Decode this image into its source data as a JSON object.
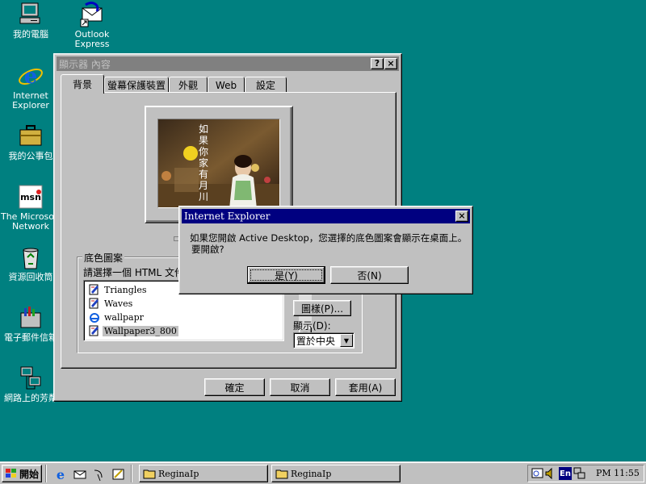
{
  "desktop": {
    "icons": [
      {
        "label": "我的電腦"
      },
      {
        "label": "Outlook Express"
      },
      {
        "label": "Internet Explorer"
      },
      {
        "label": "我的公事包"
      },
      {
        "label": "The Microsoft Network"
      },
      {
        "label": "資源回收筒"
      },
      {
        "label": "電子郵件信箱"
      },
      {
        "label": "網路上的芳鄰"
      }
    ]
  },
  "display_window": {
    "title": "顯示器 內容",
    "help_btn": "?",
    "close_btn": "×",
    "tabs": [
      {
        "label": "背景"
      },
      {
        "label": "螢幕保護裝置"
      },
      {
        "label": "外觀"
      },
      {
        "label": "Web"
      },
      {
        "label": "設定"
      }
    ],
    "preview_text": [
      "如",
      "果",
      "你",
      "家",
      "有",
      "月",
      "川"
    ],
    "group_label": "底色圖案",
    "list_prompt": "請選擇一個 HTML 文件",
    "list_items": [
      {
        "label": "Triangles"
      },
      {
        "label": "Waves"
      },
      {
        "label": "wallpapr"
      },
      {
        "label": "Wallpaper3_800"
      }
    ],
    "pattern_btn": "圖樣(P)...",
    "display_label": "顯示(D):",
    "display_value": "置於中央",
    "ok_btn": "確定",
    "cancel_btn": "取消",
    "apply_btn": "套用(A)"
  },
  "ie_dialog": {
    "title": "Internet Explorer",
    "message_line1": "如果您開啟 Active Desktop，您選擇的底色圖案會顯示在桌面上。",
    "message_line2": "要開啟?",
    "yes_btn": "是(Y)",
    "no_btn": "否(N)"
  },
  "taskbar": {
    "start": "開始",
    "tasks": [
      {
        "label": "ReginaIp"
      },
      {
        "label": "ReginaIp"
      }
    ],
    "lang": "En",
    "clock": "PM 11:55"
  }
}
